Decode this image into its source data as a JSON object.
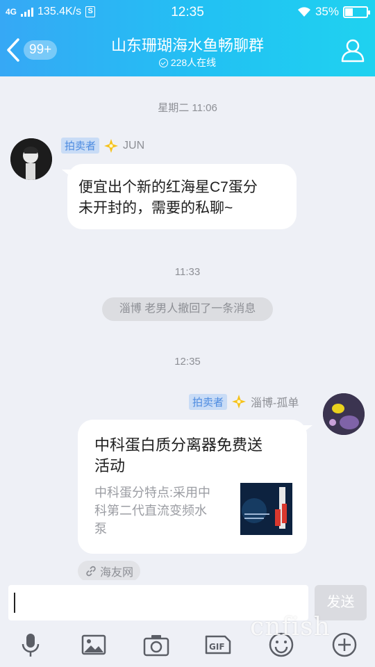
{
  "status_bar": {
    "network": "4G",
    "speed": "135.4K/s",
    "s_icon": "S",
    "time": "12:35",
    "battery": "35%",
    "battery_level": 0.35
  },
  "header": {
    "back_badge": "99+",
    "title": "山东珊瑚海水鱼畅聊群",
    "online": "228人在线"
  },
  "chat": {
    "ts1": "星期二 11:06",
    "msg1": {
      "role": "拍卖者",
      "name": "JUN",
      "lines": [
        "便宜出个新的红海星C7蛋分",
        "未开封的，需要的私聊~"
      ]
    },
    "ts2": "11:33",
    "system": "淄博 老男人撤回了一条消息",
    "ts3": "12:35",
    "msg2": {
      "role": "拍卖者",
      "name": "淄博-孤单",
      "card_title_lines": [
        "中科蛋白质分离器免费送",
        "活动"
      ],
      "card_desc_lines": [
        "中科蛋分特点:采用中",
        "科第二代直流变频水",
        "泵"
      ],
      "source": "海友网"
    }
  },
  "input": {
    "value": "",
    "send_label": "发送"
  },
  "toolbar": [
    "mic-icon",
    "image-icon",
    "camera-icon",
    "gif-icon",
    "emoji-icon",
    "plus-icon"
  ],
  "watermark": "cnfish",
  "colors": {
    "header_start": "#36a8f5",
    "header_end": "#1fd2f0",
    "role_tag_bg": "#c9dcf6",
    "role_tag_text": "#4d8be0",
    "chat_bg": "#eef0f6"
  }
}
